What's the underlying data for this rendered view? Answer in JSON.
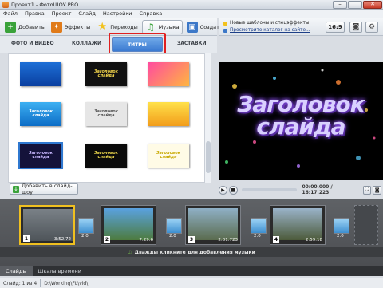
{
  "window": {
    "title": "Проект1 - ФотоШОУ PRO",
    "minimize": "–",
    "maximize": "□",
    "close": "✕"
  },
  "menu": [
    "Файл",
    "Правка",
    "Проект",
    "Слайд",
    "Настройки",
    "Справка"
  ],
  "toolbar": {
    "buttons": [
      {
        "label": "Добавить",
        "icon": "plus-icon",
        "color": "#3aa23a"
      },
      {
        "label": "Эффекты",
        "icon": "effects-icon",
        "color": "#e07b1a"
      },
      {
        "label": "Переходы",
        "icon": "transitions-icon",
        "color": "#f2c21e"
      },
      {
        "label": "Музыка",
        "icon": "music-note-icon",
        "color": "#3aa23a"
      },
      {
        "label": "Создать",
        "icon": "create-icon",
        "color": "#3c78c8"
      }
    ]
  },
  "right_panel": {
    "line1": "Новые шаблоны и спецэффекты",
    "line2": "Просмотрите каталог на сайте...",
    "ratio": "16:9",
    "icon_colors": {
      "star": "#f2c21e",
      "catalog": "#3c78c8"
    }
  },
  "tabs": {
    "photo_video": "ФОТО И ВИДЕО",
    "collages": "КОЛЛАЖИ",
    "titles": "ТИТРЫ",
    "screensavers": "ЗАСТАВКИ"
  },
  "gallery": {
    "thumbs": [
      {
        "label": "",
        "bg": "linear-gradient(#1d6fd6,#0a3fa0)"
      },
      {
        "label": "Заголовок слайда",
        "bg": "#111",
        "color": "#f1d34a"
      },
      {
        "label": "",
        "bg": "linear-gradient(135deg,#ff4aa0,#ffb640)"
      },
      {
        "label": "Заголовок слайда",
        "bg": "linear-gradient(#3db0f2,#0c6cc6)",
        "color": "#fff"
      },
      {
        "label": "Заголовок слайда",
        "bg": "#e6e6e6",
        "color": "#555"
      },
      {
        "label": "",
        "bg": "linear-gradient(#ffe14a,#f29c1a)"
      },
      {
        "label": "Заголовок слайда",
        "bg": "#14123a",
        "color": "#c8b8ff"
      },
      {
        "label": "Заголовок слайда",
        "bg": "#0a0a0a",
        "color": "#e6d24a"
      },
      {
        "label": "Заголовок слайда",
        "bg": "#fffbe6",
        "color": "#c8a800"
      }
    ]
  },
  "add_button": "Добавить в слайд-шоу",
  "preview": {
    "title_line1": "Заголовок",
    "title_line2": "слайда"
  },
  "player": {
    "time": "00:00.000 / 16:17.223"
  },
  "timeline": {
    "slides": [
      {
        "num": "1",
        "dur": "3:52.72",
        "bg": "linear-gradient(#7a8187,#4e5459)"
      },
      {
        "num": "2",
        "dur": "7:29.6",
        "bg": "linear-gradient(#5aa2e0,#4d7b3e)"
      },
      {
        "num": "3",
        "dur": "2:01.723",
        "bg": "linear-gradient(#8fb0c6,#5a6b4d)"
      },
      {
        "num": "4",
        "dur": "2:59.18",
        "bg": "linear-gradient(#9ab3c9,#4c5a3a)"
      }
    ],
    "transitions": [
      "2.0",
      "2.0",
      "2.0",
      "2.0",
      "2.0"
    ]
  },
  "audio_hint": "Дважды кликните для добавления музыки",
  "bottom_tabs": {
    "slides": "Слайды",
    "timeline": "Шкала времени"
  },
  "status": {
    "slide_info": "Слайд: 1 из 4",
    "path": "D:\\Working\\FL\\vid\\"
  }
}
